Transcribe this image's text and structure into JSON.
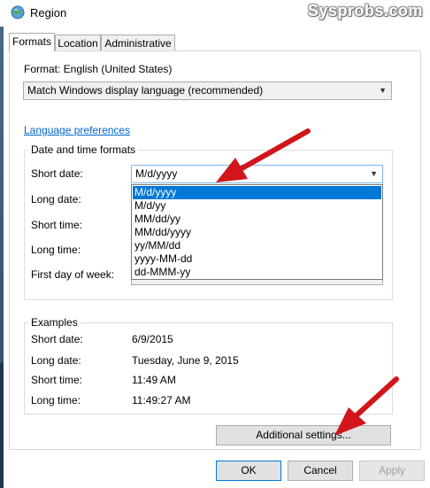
{
  "window": {
    "title": "Region",
    "watermark": "Sysprobs.com"
  },
  "tabs": [
    {
      "label": "Formats",
      "active": true
    },
    {
      "label": "Location",
      "active": false
    },
    {
      "label": "Administrative",
      "active": false
    }
  ],
  "format": {
    "label": "Format: English (United States)",
    "selected": "Match Windows display language (recommended)"
  },
  "language_preferences_link": "Language preferences",
  "date_time_formats": {
    "title": "Date and time formats",
    "short_date_label": "Short date:",
    "long_date_label": "Long date:",
    "short_time_label": "Short time:",
    "long_time_label": "Long time:",
    "first_day_label": "First day of week:",
    "short_date_value": "M/d/yyyy",
    "short_date_options": [
      "M/d/yyyy",
      "M/d/yy",
      "MM/dd/yy",
      "MM/dd/yyyy",
      "yy/MM/dd",
      "yyyy-MM-dd",
      "dd-MMM-yy"
    ],
    "highlighted_option_index": 0
  },
  "examples": {
    "title": "Examples",
    "short_date_label": "Short date:",
    "short_date_value": "6/9/2015",
    "long_date_label": "Long date:",
    "long_date_value": "Tuesday, June 9, 2015",
    "short_time_label": "Short time:",
    "short_time_value": "11:49 AM",
    "long_time_label": "Long time:",
    "long_time_value": "11:49:27 AM"
  },
  "buttons": {
    "additional_settings": "Additional settings...",
    "ok": "OK",
    "cancel": "Cancel",
    "apply": "Apply"
  },
  "colors": {
    "selection": "#0078d7",
    "link": "#0066cc",
    "annotation_arrow": "#d0161b"
  }
}
